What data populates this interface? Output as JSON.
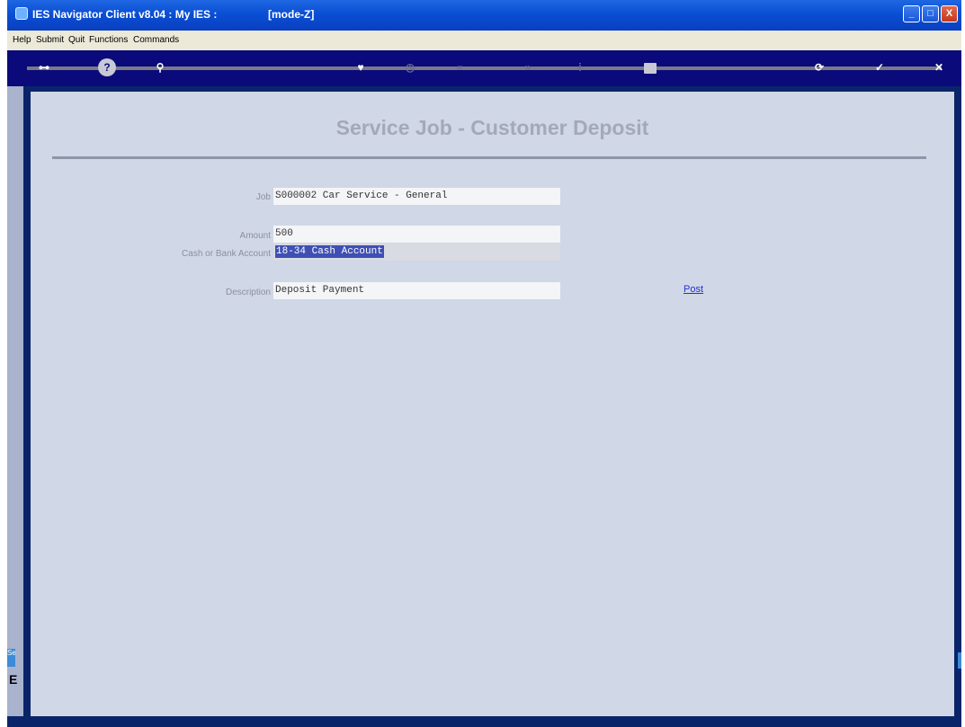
{
  "window": {
    "title": "IES Navigator Client v8.04 : My IES :",
    "mode": "[mode-Z]",
    "controls": [
      "_",
      "□",
      "X"
    ]
  },
  "menu": [
    "Help",
    "Submit",
    "Quit",
    "Functions",
    "Commands"
  ],
  "toolbar": {
    "icons": [
      "key-icon",
      "help-icon",
      "search-icon",
      "heart-icon",
      "clock-icon",
      "rewind-icon",
      "forward-icon",
      "info-icon",
      "stop-icon",
      "refresh-icon",
      "check-icon",
      "close-icon"
    ]
  },
  "form": {
    "title": "Service Job - Customer Deposit",
    "job_label": "Job",
    "job_value": "S000002 Car Service - General",
    "amount_label": "Amount",
    "amount_value": "500",
    "account_label": "Cash or Bank Account",
    "account_value": "18-34 Cash Account",
    "description_label": "Description",
    "description_value": "Deposit Payment",
    "post_link": "Post"
  },
  "side": {
    "tab_text": "Se",
    "letter": "E"
  },
  "colors": {
    "titlebar": "#0a4fd4",
    "toolbar": "#0a0a7a",
    "panel": "#d0d7e6",
    "selection": "#3f4fb4",
    "link": "#2133d1"
  }
}
